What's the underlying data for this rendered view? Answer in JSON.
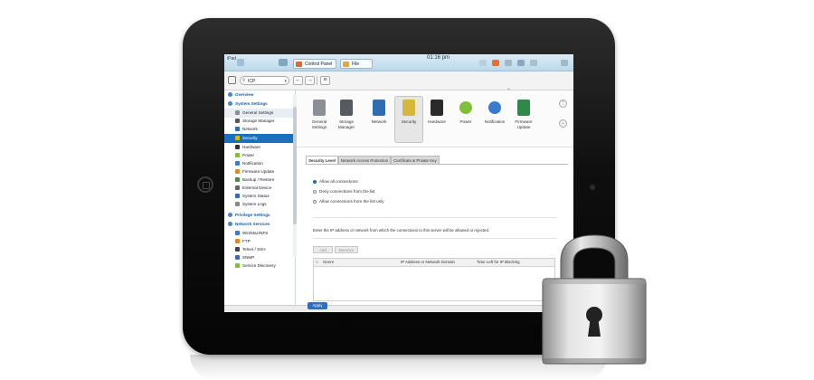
{
  "topbar": {
    "device": "iPad",
    "time": "01:16 pm",
    "tabs": [
      {
        "label": "Control Panel"
      },
      {
        "label": "File Manager"
      }
    ]
  },
  "address": {
    "value": "ICP"
  },
  "sidebar": {
    "items": [
      {
        "label": "Overview",
        "type": "section"
      },
      {
        "label": "System Settings",
        "type": "section"
      },
      {
        "label": "General Settings",
        "type": "item",
        "color": "#8a8f96"
      },
      {
        "label": "Storage Manager",
        "type": "item",
        "color": "#555a60"
      },
      {
        "label": "Network",
        "type": "item",
        "color": "#2d6db3"
      },
      {
        "label": "Security",
        "type": "selected",
        "color": "#e0b400"
      },
      {
        "label": "Hardware",
        "type": "item",
        "color": "#333333"
      },
      {
        "label": "Power",
        "type": "item",
        "color": "#7fbf3a"
      },
      {
        "label": "Notification",
        "type": "item",
        "color": "#3a7ad0"
      },
      {
        "label": "Firmware Update",
        "type": "item",
        "color": "#d98a22"
      },
      {
        "label": "Backup / Restore",
        "type": "item",
        "color": "#4a8a4a"
      },
      {
        "label": "External Device",
        "type": "item",
        "color": "#666666"
      },
      {
        "label": "System Status",
        "type": "item",
        "color": "#3a6ab0"
      },
      {
        "label": "System Logs",
        "type": "item",
        "color": "#888888"
      },
      {
        "label": "Privilege Settings",
        "type": "section"
      },
      {
        "label": "Network Services",
        "type": "section"
      },
      {
        "label": "Win/Mac/NFS",
        "type": "item",
        "color": "#3a7ad0"
      },
      {
        "label": "FTP",
        "type": "item",
        "color": "#d98a22"
      },
      {
        "label": "Telnet / SSH",
        "type": "item",
        "color": "#444444"
      },
      {
        "label": "SNMP",
        "type": "item",
        "color": "#3a6ab0"
      },
      {
        "label": "Service Discovery",
        "type": "item",
        "color": "#7fbf3a"
      }
    ]
  },
  "icon_row": {
    "items": [
      {
        "label": "General Settings",
        "icon": "general-settings-icon",
        "color": "#8a8f96"
      },
      {
        "label": "Storage Manager",
        "icon": "storage-manager-icon",
        "color": "#555a60"
      },
      {
        "label": "Network",
        "icon": "network-icon",
        "color": "#2d6db3"
      },
      {
        "label": "Security",
        "icon": "security-lock-icon",
        "color": "#d7b73a"
      },
      {
        "label": "Hardware",
        "icon": "hardware-icon",
        "color": "#2a2a2a"
      },
      {
        "label": "Power",
        "icon": "power-icon",
        "color": "#7fbf3a"
      },
      {
        "label": "Notification",
        "icon": "notification-icon",
        "color": "#3a7ad0"
      },
      {
        "label": "Firmware Update",
        "icon": "firmware-update-icon",
        "color": "#2f8a4a"
      }
    ]
  },
  "sub_tabs": [
    {
      "label": "Security Level"
    },
    {
      "label": "Network Access Protection"
    },
    {
      "label": "Certificate & Private Key"
    }
  ],
  "security_level": {
    "options": [
      {
        "label": "Allow all connections",
        "selected": true
      },
      {
        "label": "Deny connections from the list",
        "selected": false
      },
      {
        "label": "Allow connections from the list only",
        "selected": false
      }
    ],
    "description": "Enter the IP address or network from which the connections to this server will be allowed or rejected.",
    "add_label": "Add",
    "remove_label": "Remove",
    "columns": [
      "Genre",
      "IP Address or Network Domain",
      "Time Left for IP Blocking"
    ],
    "apply_label": "Apply"
  }
}
